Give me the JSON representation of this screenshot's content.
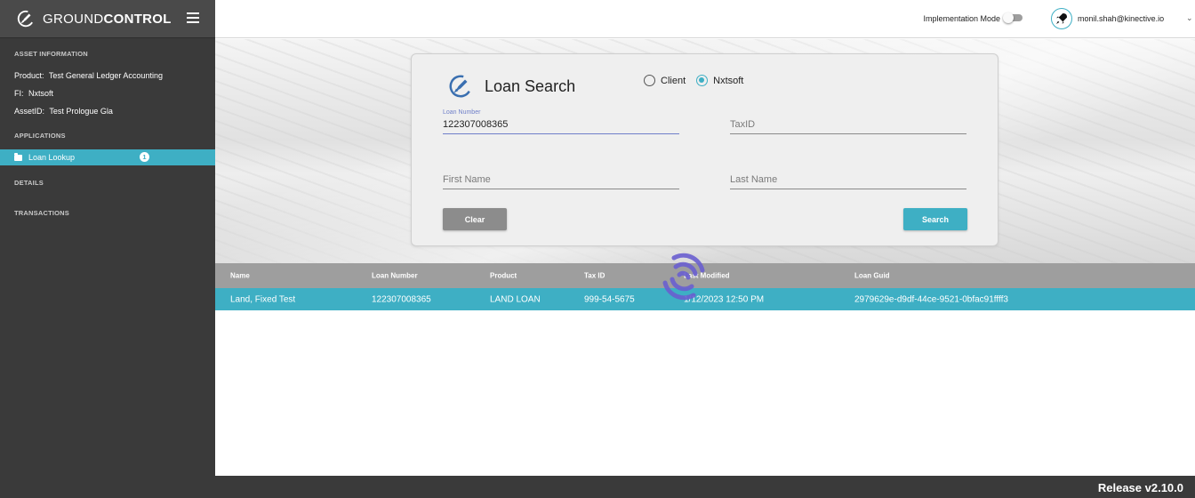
{
  "brand": {
    "name_light": "GROUND",
    "name_bold": "CONTROL"
  },
  "sidebar": {
    "asset_section": "ASSET INFORMATION",
    "product_key": "Product:",
    "product_val": "Test General Ledger Accounting",
    "fi_key": "FI:",
    "fi_val": "Nxtsoft",
    "asset_key": "AssetID:",
    "asset_val": "Test Prologue Gla",
    "applications_section": "APPLICATIONS",
    "active_item": "Loan Lookup",
    "active_badge": "1",
    "details_section": "DETAILS",
    "transactions_section": "TRANSACTIONS"
  },
  "topbar": {
    "implementation_mode": "Implementation Mode",
    "implementation_on": false,
    "user_email": "monil.shah@kinective.io",
    "menu_chevron": "⌄"
  },
  "search": {
    "title": "Loan Search",
    "radio_client": "Client",
    "radio_nxtsoft": "Nxtsoft",
    "selected": "Nxtsoft",
    "loan_number_label": "Loan Number",
    "loan_number_value": "122307008365",
    "taxid_placeholder": "TaxID",
    "first_name_placeholder": "First Name",
    "last_name_placeholder": "Last Name",
    "clear_label": "Clear",
    "search_label": "Search"
  },
  "table": {
    "headers": [
      "Name",
      "Loan Number",
      "Product",
      "Tax ID",
      "Last Modified",
      "Loan Guid"
    ],
    "rows": [
      [
        "Land, Fixed Test",
        "122307008365",
        "LAND LOAN",
        "999-54-5675",
        "1/12/2023 12:50 PM",
        "2979629e-d9df-44ce-9521-0bfac91ffff3"
      ]
    ]
  },
  "footer": {
    "release": "Release v2.10.0"
  },
  "colors": {
    "accent": "#3eafc4",
    "sidebar": "#3a3a3a",
    "loader": "#6a5fd0",
    "focus": "#6f7fc9"
  }
}
